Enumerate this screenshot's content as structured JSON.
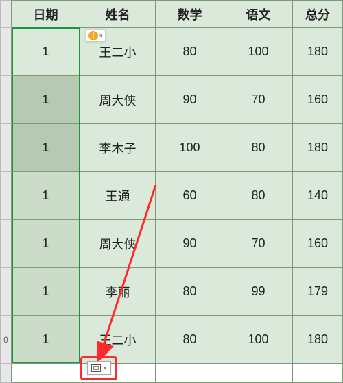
{
  "headers": {
    "date": "日期",
    "name": "姓名",
    "math": "数学",
    "chinese": "语文",
    "total": "总分"
  },
  "rows": [
    {
      "date": "1",
      "name": "王二小",
      "math": "80",
      "chinese": "100",
      "total": "180"
    },
    {
      "date": "1",
      "name": "周大侠",
      "math": "90",
      "chinese": "70",
      "total": "160"
    },
    {
      "date": "1",
      "name": "李木子",
      "math": "100",
      "chinese": "80",
      "total": "180"
    },
    {
      "date": "1",
      "name": "王通",
      "math": "60",
      "chinese": "80",
      "total": "140"
    },
    {
      "date": "1",
      "name": "周大侠",
      "math": "90",
      "chinese": "70",
      "total": "160"
    },
    {
      "date": "1",
      "name": "李丽",
      "math": "80",
      "chinese": "99",
      "total": "179"
    },
    {
      "date": "1",
      "name": "王二小",
      "math": "80",
      "chinese": "100",
      "total": "180"
    }
  ],
  "row_labels": {
    "last_visible": "0"
  },
  "smart_tag": {
    "badge": "!"
  },
  "chart_data": {
    "type": "table",
    "columns": [
      "日期",
      "姓名",
      "数学",
      "语文",
      "总分"
    ],
    "data": [
      [
        1,
        "王二小",
        80,
        100,
        180
      ],
      [
        1,
        "周大侠",
        90,
        70,
        160
      ],
      [
        1,
        "李木子",
        100,
        80,
        180
      ],
      [
        1,
        "王通",
        60,
        80,
        140
      ],
      [
        1,
        "周大侠",
        90,
        70,
        160
      ],
      [
        1,
        "李丽",
        80,
        99,
        179
      ],
      [
        1,
        "王二小",
        80,
        100,
        180
      ]
    ],
    "title": "",
    "annotation": "红色箭头与红框指示选区下方的自动填充 / 粘贴选项按钮"
  }
}
